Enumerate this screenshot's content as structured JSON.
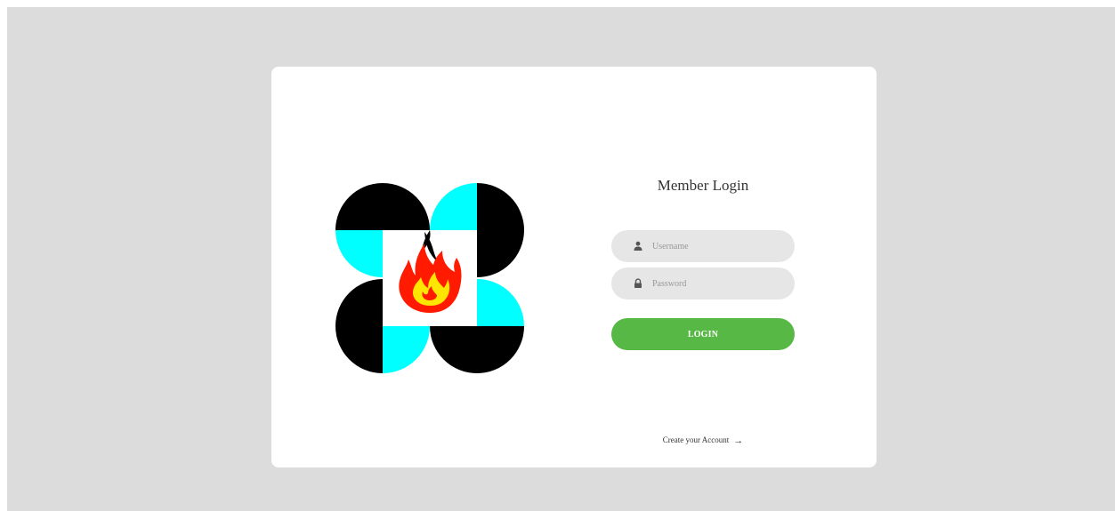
{
  "form": {
    "title": "Member Login",
    "username_placeholder": "Username",
    "password_placeholder": "Password",
    "login_label": "LOGIN",
    "create_account_label": "Create your Account",
    "create_account_arrow": "→"
  },
  "icons": {
    "username": "user-icon",
    "password": "lock-icon",
    "logo": "bfp-logo"
  },
  "colors": {
    "page_background": "#dcdcdc",
    "card_background": "#ffffff",
    "field_background": "#e6e6e6",
    "login_button": "#57b846",
    "logo_cyan": "#00ffff",
    "logo_black": "#000000",
    "flame_red": "#ff1a00",
    "flame_yellow": "#ffe600"
  }
}
